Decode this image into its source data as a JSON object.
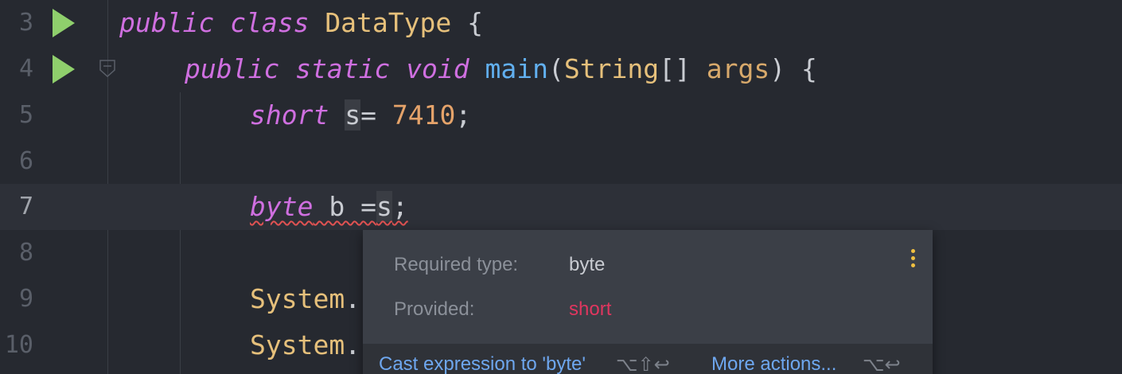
{
  "editor": {
    "lines": [
      {
        "number": "3",
        "tokens": {
          "t1": "public",
          "t2": "class",
          "t3": "DataType",
          "t4": "{"
        }
      },
      {
        "number": "4",
        "tokens": {
          "t1": "public",
          "t2": "static",
          "t3": "void",
          "t4": "main",
          "t5": "(",
          "t6": "String",
          "t7": "[] ",
          "t8": "args",
          "t9": ") {"
        }
      },
      {
        "number": "5",
        "tokens": {
          "t1": "short",
          "t2": "s",
          "t3": "= ",
          "t4": "7410",
          "t5": ";"
        }
      },
      {
        "number": "6"
      },
      {
        "number": "7",
        "tokens": {
          "t1": "byte",
          "t2": " b =",
          "t3": "s",
          "t4": ";"
        }
      },
      {
        "number": "8"
      },
      {
        "number": "9",
        "tokens": {
          "t1": "System",
          "t2": "."
        }
      },
      {
        "number": "10",
        "tokens": {
          "t1": "System",
          "t2": "."
        }
      }
    ],
    "icons": {
      "run": "run-icon",
      "fold": "fold-marker-icon"
    }
  },
  "error_popup": {
    "required_label": "Required type:",
    "required_value": "byte",
    "provided_label": "Provided:",
    "provided_value": "short",
    "fix_action": "Cast expression to 'byte'",
    "fix_shortcut": "⌥⇧↩",
    "more_actions": "More actions...",
    "more_shortcut": "⌥↩",
    "menu_icon": "kebab-menu-icon"
  },
  "colors": {
    "background": "#262930",
    "keyword": "#cf6fe0",
    "class_name": "#e6c07b",
    "function": "#61afef",
    "number": "#e5a36a",
    "error_value": "#e0365f",
    "link": "#6ea7ef",
    "run_icon": "#8fcf6c"
  }
}
